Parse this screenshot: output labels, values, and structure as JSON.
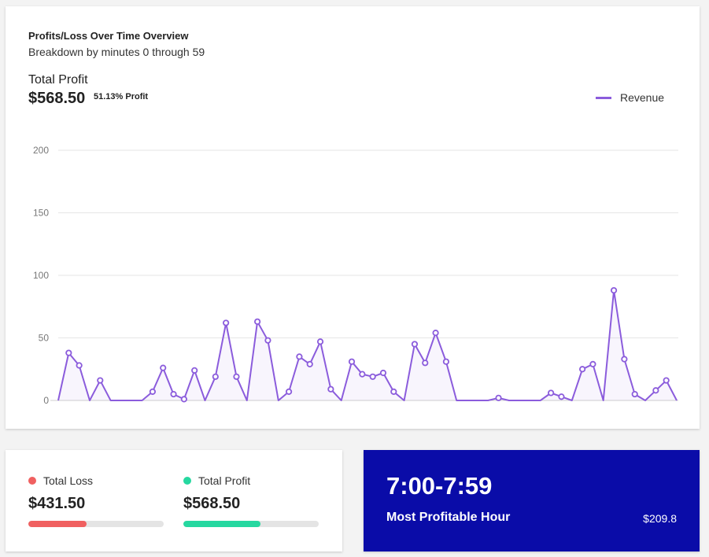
{
  "chart_card": {
    "title": "Profits/Loss Over Time Overview",
    "subtitle": "Breakdown by minutes 0 through 59",
    "total_label": "Total Profit",
    "total_value": "$568.50",
    "total_pct": "51.13% Profit"
  },
  "chart_data": {
    "type": "area",
    "title": "Profits/Loss Over Time Overview",
    "subtitle": "Breakdown by minutes 0 through 59",
    "ylim": [
      0,
      200
    ],
    "yticks": [
      0,
      50,
      100,
      150,
      200
    ],
    "grid": true,
    "legend_position": "top-right",
    "series": [
      {
        "name": "Revenue",
        "color": "#8b5cdc",
        "values": [
          0,
          38,
          28,
          0,
          16,
          0,
          0,
          0,
          0,
          7,
          26,
          5,
          1,
          24,
          0,
          19,
          62,
          19,
          0,
          63,
          48,
          0,
          7,
          35,
          29,
          47,
          9,
          0,
          31,
          21,
          19,
          22,
          7,
          0,
          45,
          30,
          54,
          31,
          0,
          0,
          0,
          0,
          2,
          0,
          0,
          0,
          0,
          6,
          3,
          0,
          25,
          29,
          0,
          88,
          33,
          5,
          0,
          8,
          16,
          0
        ]
      }
    ]
  },
  "stats": {
    "loss": {
      "label": "Total Loss",
      "value": "$431.50",
      "fraction": 0.4315,
      "color": "#f06060"
    },
    "profit": {
      "label": "Total Profit",
      "value": "$568.50",
      "fraction": 0.5685,
      "color": "#26d8a0"
    }
  },
  "best_hour": {
    "range": "7:00-7:59",
    "label": "Most Profitable Hour",
    "amount": "$209.8",
    "background": "#0a0ca8"
  }
}
